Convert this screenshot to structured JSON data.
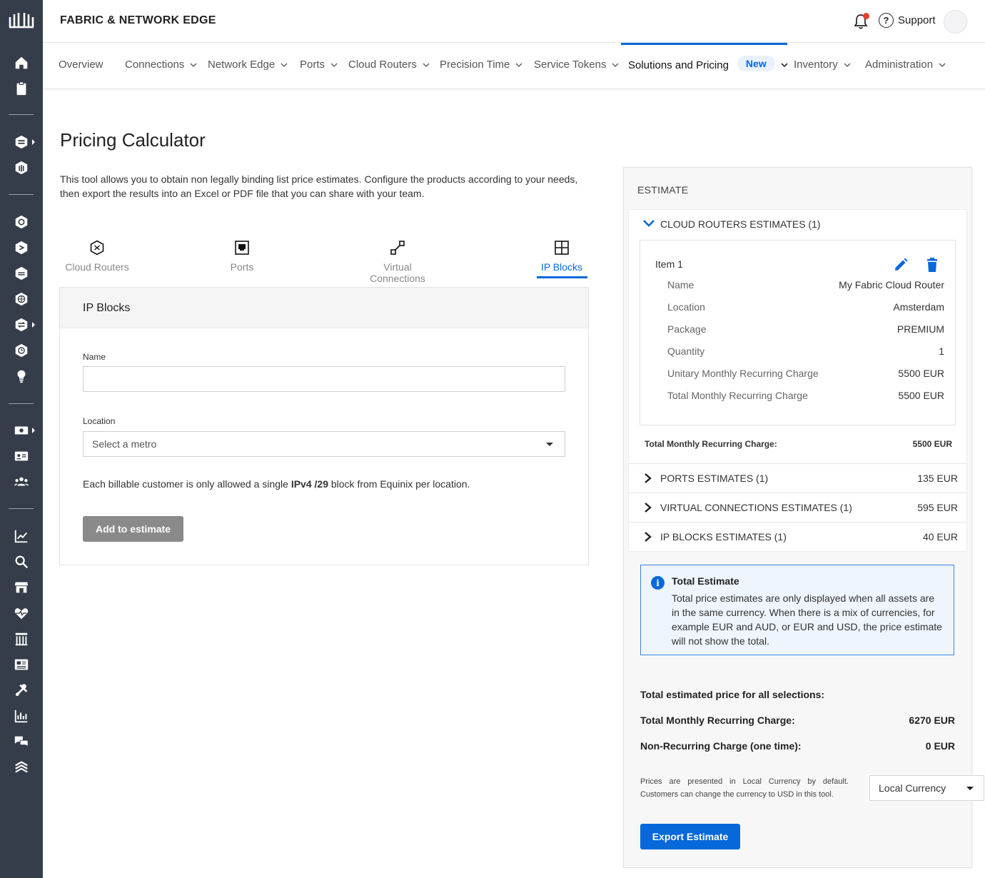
{
  "header": {
    "brand": "FABRIC & NETWORK EDGE",
    "support_label": "Support"
  },
  "nav": {
    "items": [
      {
        "label": "Overview"
      },
      {
        "label": "Connections"
      },
      {
        "label": "Network Edge"
      },
      {
        "label": "Ports"
      },
      {
        "label": "Cloud Routers"
      },
      {
        "label": "Precision Time"
      },
      {
        "label": "Service Tokens"
      },
      {
        "label": "Solutions and Pricing",
        "badge": "New"
      },
      {
        "label": "Inventory"
      },
      {
        "label": "Administration"
      }
    ],
    "active": "Solutions and Pricing"
  },
  "page": {
    "title": "Pricing Calculator",
    "intro": "This tool allows you to obtain non legally binding list price estimates. Configure the products according to your needs, then export the results into an Excel or PDF file that you can share with your team."
  },
  "product_tabs": [
    {
      "label": "Cloud Routers",
      "icon": "cloud-router-icon"
    },
    {
      "label": "Ports",
      "icon": "port-icon"
    },
    {
      "label": "Virtual Connections",
      "icon": "virtual-connection-icon"
    },
    {
      "label": "IP Blocks",
      "icon": "ip-blocks-icon",
      "active": true
    }
  ],
  "form": {
    "heading": "IP Blocks",
    "name_label": "Name",
    "name_value": "",
    "location_label": "Location",
    "location_placeholder": "Select a metro",
    "rule_prefix": "Each billable customer is only allowed a single ",
    "rule_bold": "IPv4 /29",
    "rule_suffix": " block from Equinix per location.",
    "add_button": "Add to estimate"
  },
  "estimate": {
    "title": "ESTIMATE",
    "cloud_routers": {
      "header": "CLOUD ROUTERS ESTIMATES (1)",
      "item_title": "Item 1",
      "fields": [
        {
          "label": "Name",
          "value": "My Fabric Cloud Router"
        },
        {
          "label": "Location",
          "value": "Amsterdam"
        },
        {
          "label": "Package",
          "value": "PREMIUM"
        },
        {
          "label": "Quantity",
          "value": "1"
        },
        {
          "label": "Unitary Monthly Recurring Charge",
          "value": "5500 EUR"
        },
        {
          "label": "Total Monthly Recurring Charge",
          "value": "5500 EUR"
        }
      ],
      "subtotal_label": "Total Monthly Recurring Charge:",
      "subtotal_value": "5500 EUR"
    },
    "collapsed": [
      {
        "label": "PORTS ESTIMATES (1)",
        "amount": "135 EUR"
      },
      {
        "label": "VIRTUAL CONNECTIONS ESTIMATES (1)",
        "amount": "595 EUR"
      },
      {
        "label": "IP BLOCKS ESTIMATES (1)",
        "amount": "40 EUR"
      }
    ],
    "info": {
      "title": "Total Estimate",
      "body": "Total price estimates are only displayed when all assets are in the same currency. When there is a mix of currencies, for example EUR and AUD, or EUR and USD, the price estimate will not show the total."
    },
    "totals_heading": "Total estimated price for all selections:",
    "mrc_label": "Total Monthly Recurring Charge:",
    "mrc_value": "6270 EUR",
    "nrc_label": "Non-Recurring Charge (one time):",
    "nrc_value": "0 EUR",
    "currency_note": "Prices are presented in Local Currency by default. Customers can change the currency to USD in this tool.",
    "currency_selected": "Local Currency",
    "export_button": "Export Estimate"
  },
  "colors": {
    "accent": "#0768d9",
    "rail": "#363d4a",
    "notification": "#e8402a"
  }
}
